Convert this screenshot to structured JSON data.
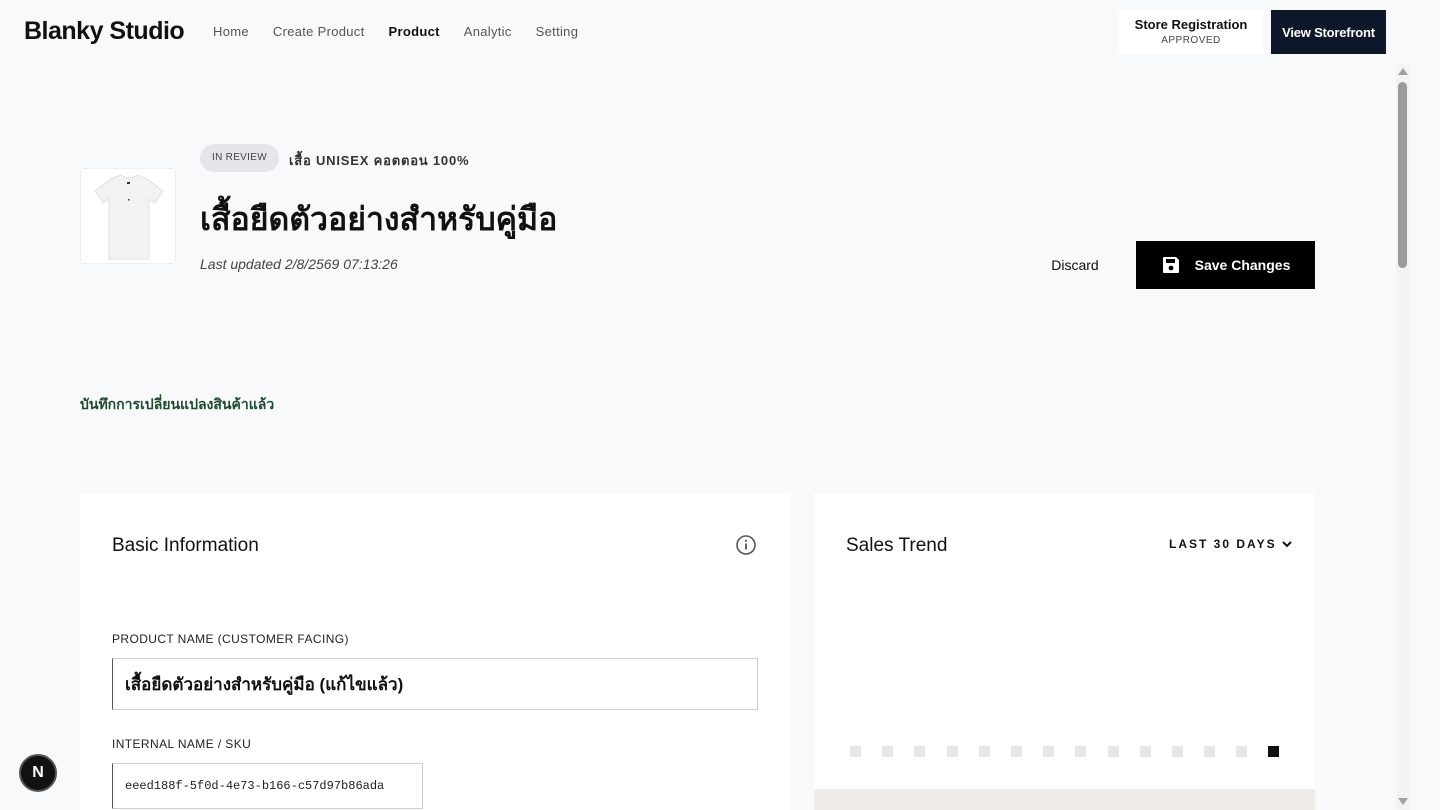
{
  "header": {
    "brand": "Blanky Studio",
    "nav": [
      {
        "label": "Home",
        "active": false
      },
      {
        "label": "Create Product",
        "active": false
      },
      {
        "label": "Product",
        "active": true
      },
      {
        "label": "Analytic",
        "active": false
      },
      {
        "label": "Setting",
        "active": false
      }
    ],
    "store_registration": {
      "label": "Store Registration",
      "status": "APPROVED"
    },
    "view_storefront": "View Storefront"
  },
  "product": {
    "status": "IN REVIEW",
    "subtitle": "เสื้อ UNISEX คอตตอน 100%",
    "title": "เสื้อยืดตัวอย่างสำหรับคู่มือ",
    "last_updated": "Last updated 2/8/2569 07:13:26",
    "discard_label": "Discard",
    "save_label": "Save Changes"
  },
  "message": "บันทึกการเปลี่ยนแปลงสินค้าแล้ว",
  "basic_info": {
    "title": "Basic Information",
    "product_name_label": "PRODUCT NAME (CUSTOMER FACING)",
    "product_name_value": "เสื้อยืดตัวอย่างสำหรับคู่มือ (แก้ไขแล้ว)",
    "sku_label": "INTERNAL NAME / SKU",
    "sku_value": "eeed188f-5f0d-4e73-b166-c57d97b86ada"
  },
  "sales_trend": {
    "title": "Sales Trend",
    "range": "LAST 30 DAYS"
  },
  "badge": "N",
  "colors": {
    "accent": "#000000",
    "storefront_button": "#0f172a",
    "success_text": "#1f4a2e",
    "status_badge_bg": "#e4e7ea"
  }
}
